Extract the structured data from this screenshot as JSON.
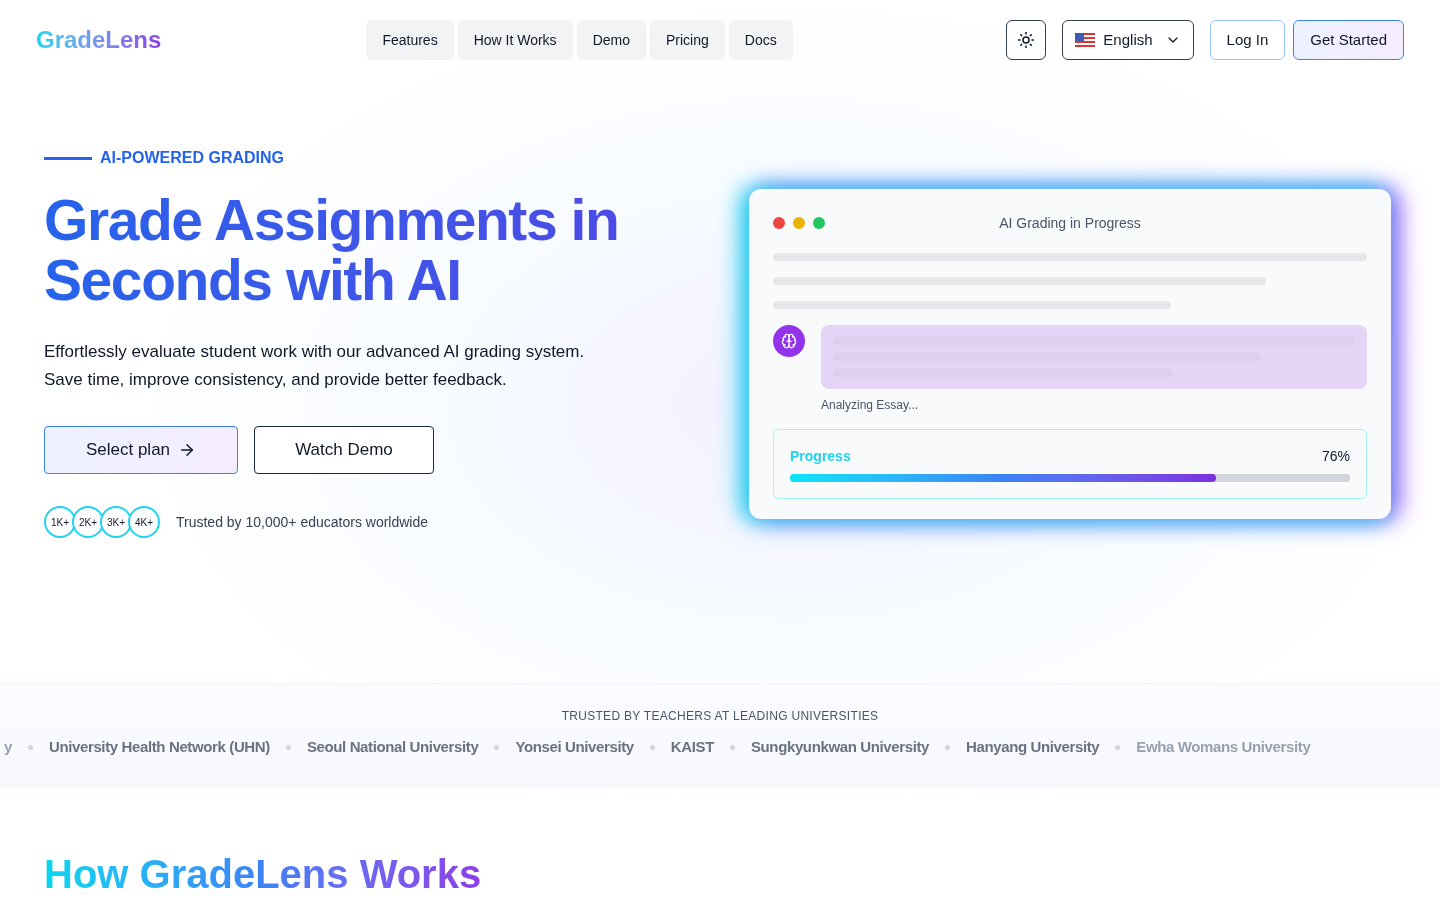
{
  "header": {
    "logo": "GradeLens",
    "nav": [
      {
        "label": "Features"
      },
      {
        "label": "How It Works"
      },
      {
        "label": "Demo"
      },
      {
        "label": "Pricing"
      },
      {
        "label": "Docs"
      }
    ],
    "language": "English",
    "login": "Log In",
    "cta": "Get Started"
  },
  "hero": {
    "eyebrow": "AI-POWERED GRADING",
    "title": "Grade Assignments in Seconds with AI",
    "description": "Effortlessly evaluate student work with our advanced AI grading system. Save time, improve consistency, and provide better feedback.",
    "primary_button": "Select plan",
    "secondary_button": "Watch Demo",
    "avatars": [
      "1K+",
      "2K+",
      "3K+",
      "4K+"
    ],
    "trust_text": "Trusted by 10,000+ educators worldwide"
  },
  "demo_card": {
    "title": "AI Grading in Progress",
    "status": "Analyzing Essay...",
    "progress_label": "Progress",
    "progress_reading": "76%",
    "level": 0.76
  },
  "universities": {
    "heading": "TRUSTED BY TEACHERS AT LEADING UNIVERSITIES",
    "items": [
      "y",
      "University Health Network (UHN)",
      "Seoul National University",
      "Yonsei University",
      "KAIST",
      "Sungkyunkwan University",
      "Hanyang University",
      "Ewha Womans University"
    ]
  },
  "next_section": {
    "title": "How GradeLens Works"
  }
}
